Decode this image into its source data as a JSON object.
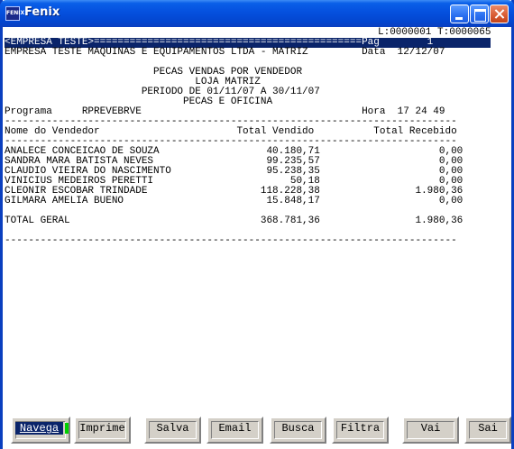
{
  "window": {
    "title": "Fenix",
    "icon_text": "FENIX"
  },
  "status_line": "L:0000001 T:0000065",
  "report": {
    "header_line": "<EMPRESA TESTE>=============================================Pag        1",
    "company_line": "EMPRESA TESTE MAQUINAS E EQUIPAMENTOS LTDA - MATRIZ         Data  12/12/07",
    "title_lines": [
      "                         PECAS VENDAS POR VENDEDOR",
      "                                LOJA MATRIZ",
      "                       PERIODO DE 01/11/07 A 30/11/07",
      "                              PECAS E OFICINA"
    ],
    "program_line": "Programa     RPREVEBRVE                                     Hora  17 24 49",
    "separator": "----------------------------------------------------------------------------",
    "columns_line": "Nome do Vendedor                       Total Vendido          Total Recebido",
    "rows": [
      "ANALECE CONCEICAO DE SOUZA                  40.180,71                    0,00",
      "SANDRA MARA BATISTA NEVES                   99.235,57                    0,00",
      "CLAUDIO VIEIRA DO NASCIMENTO                95.238,35                    0,00",
      "VINICIUS MEDEIROS PERETTI                       50,18                    0,00",
      "CLEONIR ESCOBAR TRINDADE                   118.228,38                1.980,36",
      "GILMARA AMELIA BUENO                        15.848,17                    0,00"
    ],
    "total_line": "TOTAL GERAL                                368.781,36                1.980,36",
    "final_separator": "----------------------------------------------------------------------------"
  },
  "buttons": {
    "navega": "Navega",
    "imprime": "Imprime",
    "salva": "Salva",
    "email": "Email",
    "busca": "Busca",
    "filtra": "Filtra",
    "vai": "Vai",
    "sai": "Sai"
  },
  "colors": {
    "titlebar": "#0550de",
    "highlight": "#0a246a",
    "cursor": "#00d000",
    "button_face": "#d4d0c8"
  }
}
